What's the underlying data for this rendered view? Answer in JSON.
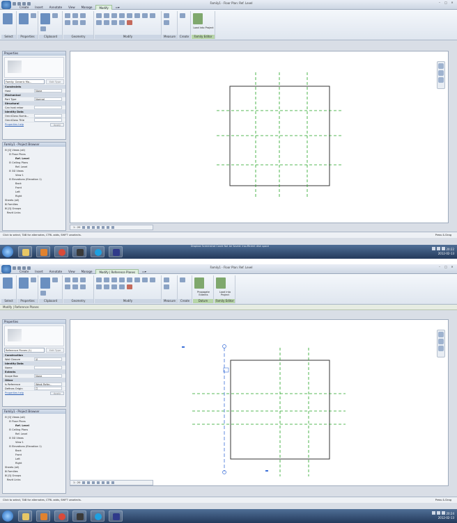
{
  "colors": {
    "accent": "#2a5d9e",
    "ref_plane": "#21a321",
    "wall_line": "#333333",
    "selected_plane": "#3b6fd8"
  },
  "top": {
    "title": "Family1 - Floor Plan: Ref. Level",
    "tabs": [
      "Create",
      "Insert",
      "Annotate",
      "View",
      "Manage",
      "Modify",
      "▭▾"
    ],
    "active_tab": "Modify",
    "panels": [
      "Select",
      "Properties",
      "Clipboard",
      "Geometry",
      "Modify",
      "Measure",
      "Create",
      "Family Editor"
    ],
    "modify_label": "Modify",
    "load_label": "Load into Project",
    "properties": {
      "header": "Properties",
      "type_selector": "Family: Generic Mo...",
      "edit_type": "Edit Type",
      "rows": [
        {
          "label": "Constraints",
          "cat": true,
          "value": ""
        },
        {
          "label": "Host",
          "cat": false,
          "value": "None"
        },
        {
          "label": "Mechanical",
          "cat": true,
          "value": ""
        },
        {
          "label": "Part Type",
          "cat": false,
          "value": "Normal"
        },
        {
          "label": "Structural",
          "cat": true,
          "value": ""
        },
        {
          "label": "Can host rebar",
          "cat": false,
          "value": ""
        },
        {
          "label": "Identity Data",
          "cat": true,
          "value": ""
        },
        {
          "label": "OmniClass Numb...",
          "cat": false,
          "value": ""
        },
        {
          "label": "OmniClass Title",
          "cat": false,
          "value": ""
        }
      ],
      "help": "Properties help",
      "apply": "Apply"
    },
    "browser": {
      "header": "Family1 - Project Browser",
      "items": [
        {
          "label": "⊟ [0] Views (all)",
          "indent": 1,
          "bold": false
        },
        {
          "label": "⊟ Floor Plans",
          "indent": 3,
          "bold": false
        },
        {
          "label": "Ref. Level",
          "indent": 6,
          "bold": true
        },
        {
          "label": "⊟ Ceiling Plans",
          "indent": 3,
          "bold": false
        },
        {
          "label": "Ref. Level",
          "indent": 6,
          "bold": false
        },
        {
          "label": "⊟ 3D Views",
          "indent": 3,
          "bold": false
        },
        {
          "label": "View 1",
          "indent": 6,
          "bold": false
        },
        {
          "label": "⊟ Elevations (Elevation 1)",
          "indent": 3,
          "bold": false
        },
        {
          "label": "Back",
          "indent": 6,
          "bold": false
        },
        {
          "label": "Front",
          "indent": 6,
          "bold": false
        },
        {
          "label": "Left",
          "indent": 6,
          "bold": false
        },
        {
          "label": "Right",
          "indent": 6,
          "bold": false
        },
        {
          "label": "Sheets (all)",
          "indent": 1,
          "bold": false
        },
        {
          "label": "⊞ Families",
          "indent": 1,
          "bold": false
        },
        {
          "label": "⊞ [0] Groups",
          "indent": 1,
          "bold": false
        },
        {
          "label": "Revit Links",
          "indent": 2,
          "bold": false
        }
      ]
    },
    "scale": "1 : 20",
    "status": "Click to select, TAB for alternates, CTRL adds, SHIFT unselects.",
    "press_drag": "Press & Drag",
    "taskbar_notice": "Dropbox Screenshot Could Not be Saved: Insufficient disk space",
    "clock_time": "20:22",
    "clock_date": "2012-02-13"
  },
  "bottom": {
    "title": "Family1 - Floor Plan: Ref. Level",
    "tabs": [
      "Create",
      "Insert",
      "Annotate",
      "View",
      "Manage",
      "Modify | Reference Planes",
      "▭▾"
    ],
    "active_tab": "Modify | Reference Planes",
    "panels": [
      "Select",
      "Properties",
      "Clipboard",
      "Geometry",
      "Modify",
      "Measure",
      "Create",
      "Datum",
      "Family Editor"
    ],
    "context_label": "Modify | Reference Planes",
    "modify_label": "Modify",
    "propagate_label": "Propagate Extents",
    "load_label": "Load into Project",
    "properties": {
      "header": "Properties",
      "type_selector": "Reference Planes (1)",
      "edit_type": "Edit Type",
      "rows": [
        {
          "label": "Construction",
          "cat": true,
          "value": ""
        },
        {
          "label": "Wall Closure",
          "cat": false,
          "value": "☑"
        },
        {
          "label": "Identity Data",
          "cat": true,
          "value": ""
        },
        {
          "label": "Name",
          "cat": false,
          "value": ""
        },
        {
          "label": "Extents",
          "cat": true,
          "value": ""
        },
        {
          "label": "Scope Box",
          "cat": false,
          "value": "None"
        },
        {
          "label": "Other",
          "cat": true,
          "value": ""
        },
        {
          "label": "Is Reference",
          "cat": false,
          "value": "Weak Refer..."
        },
        {
          "label": "Defines Origin",
          "cat": false,
          "value": "☐"
        }
      ],
      "help": "Properties help",
      "apply": "Apply"
    },
    "browser": {
      "header": "Family1 - Project Browser",
      "items": [
        {
          "label": "⊟ [0] Views (all)",
          "indent": 1,
          "bold": false
        },
        {
          "label": "⊟ Floor Plans",
          "indent": 3,
          "bold": false
        },
        {
          "label": "Ref. Level",
          "indent": 6,
          "bold": true
        },
        {
          "label": "⊟ Ceiling Plans",
          "indent": 3,
          "bold": false
        },
        {
          "label": "Ref. Level",
          "indent": 6,
          "bold": false
        },
        {
          "label": "⊟ 3D Views",
          "indent": 3,
          "bold": false
        },
        {
          "label": "View 1",
          "indent": 6,
          "bold": false
        },
        {
          "label": "⊟ Elevations (Elevation 1)",
          "indent": 3,
          "bold": false
        },
        {
          "label": "Back",
          "indent": 6,
          "bold": false
        },
        {
          "label": "Front",
          "indent": 6,
          "bold": false
        },
        {
          "label": "Left",
          "indent": 6,
          "bold": false
        },
        {
          "label": "Right",
          "indent": 6,
          "bold": false
        },
        {
          "label": "Sheets (all)",
          "indent": 1,
          "bold": false
        },
        {
          "label": "⊞ Families",
          "indent": 1,
          "bold": false
        },
        {
          "label": "⊞ [0] Groups",
          "indent": 1,
          "bold": false
        },
        {
          "label": "Revit Links",
          "indent": 2,
          "bold": false
        }
      ]
    },
    "scale": "1 : 20",
    "status": "Click to select, TAB for alternates, CTRL adds, SHIFT unselects.",
    "press_drag": "Press & Drag",
    "clock_time": "20:24",
    "clock_date": "2012-02-13"
  }
}
